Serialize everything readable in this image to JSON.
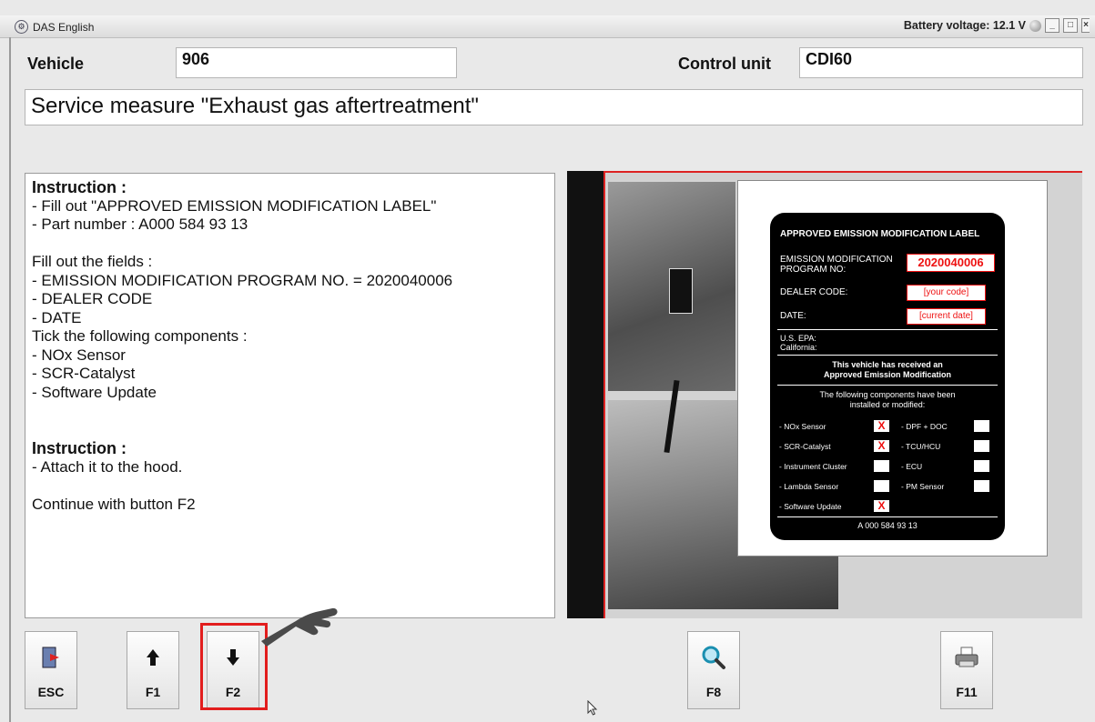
{
  "window": {
    "title": "DAS English",
    "battery": "Battery voltage: 12.1 V"
  },
  "header": {
    "vehicle_label": "Vehicle",
    "vehicle_value": "906",
    "control_unit_label": "Control unit",
    "control_unit_value": "CDI60",
    "service_measure": "Service measure \"Exhaust gas aftertreatment\""
  },
  "instructions": {
    "lines": [
      "Instruction :",
      "- Fill out \"APPROVED EMISSION MODIFICATION LABEL\"",
      "- Part number : A000 584 93 13",
      "",
      "Fill out the fields :",
      "- EMISSION MODIFICATION PROGRAM NO. = 2020040006",
      "- DEALER CODE",
      "- DATE",
      "Tick the following components :",
      "- NOx Sensor",
      "- SCR-Catalyst",
      "- Software Update",
      "",
      "",
      "Instruction :",
      "- Attach it to the hood.",
      "",
      "Continue with button F2"
    ]
  },
  "emission_label": {
    "title": "APPROVED EMISSION MODIFICATION LABEL",
    "program_label": "EMISSION MODIFICATION PROGRAM NO:",
    "program_value": "2020040006",
    "dealer_label": "DEALER CODE:",
    "dealer_value": "[your code]",
    "date_label": "DATE:",
    "date_value": "[current date]",
    "epa": "U.S. EPA:",
    "california": "California:",
    "received_1": "This vehicle has received an",
    "received_2": "Approved Emission Modification",
    "components_1": "The following components have been",
    "components_2": "installed or modified:",
    "left_items": [
      "- NOx Sensor",
      "- SCR-Catalyst",
      "- Instrument Cluster",
      "- Lambda Sensor",
      "- Software Update"
    ],
    "left_checked": [
      "X",
      "X",
      "",
      "",
      "X"
    ],
    "right_items": [
      "- DPF + DOC",
      "- TCU/HCU",
      "- ECU",
      "- PM Sensor"
    ],
    "part_number": "A 000 584 93 13"
  },
  "buttons": {
    "esc": "ESC",
    "f1": "F1",
    "f2": "F2",
    "f8": "F8",
    "f11": "F11"
  },
  "colors": {
    "highlight": "#e21d1d",
    "check_red": "#e11111"
  }
}
